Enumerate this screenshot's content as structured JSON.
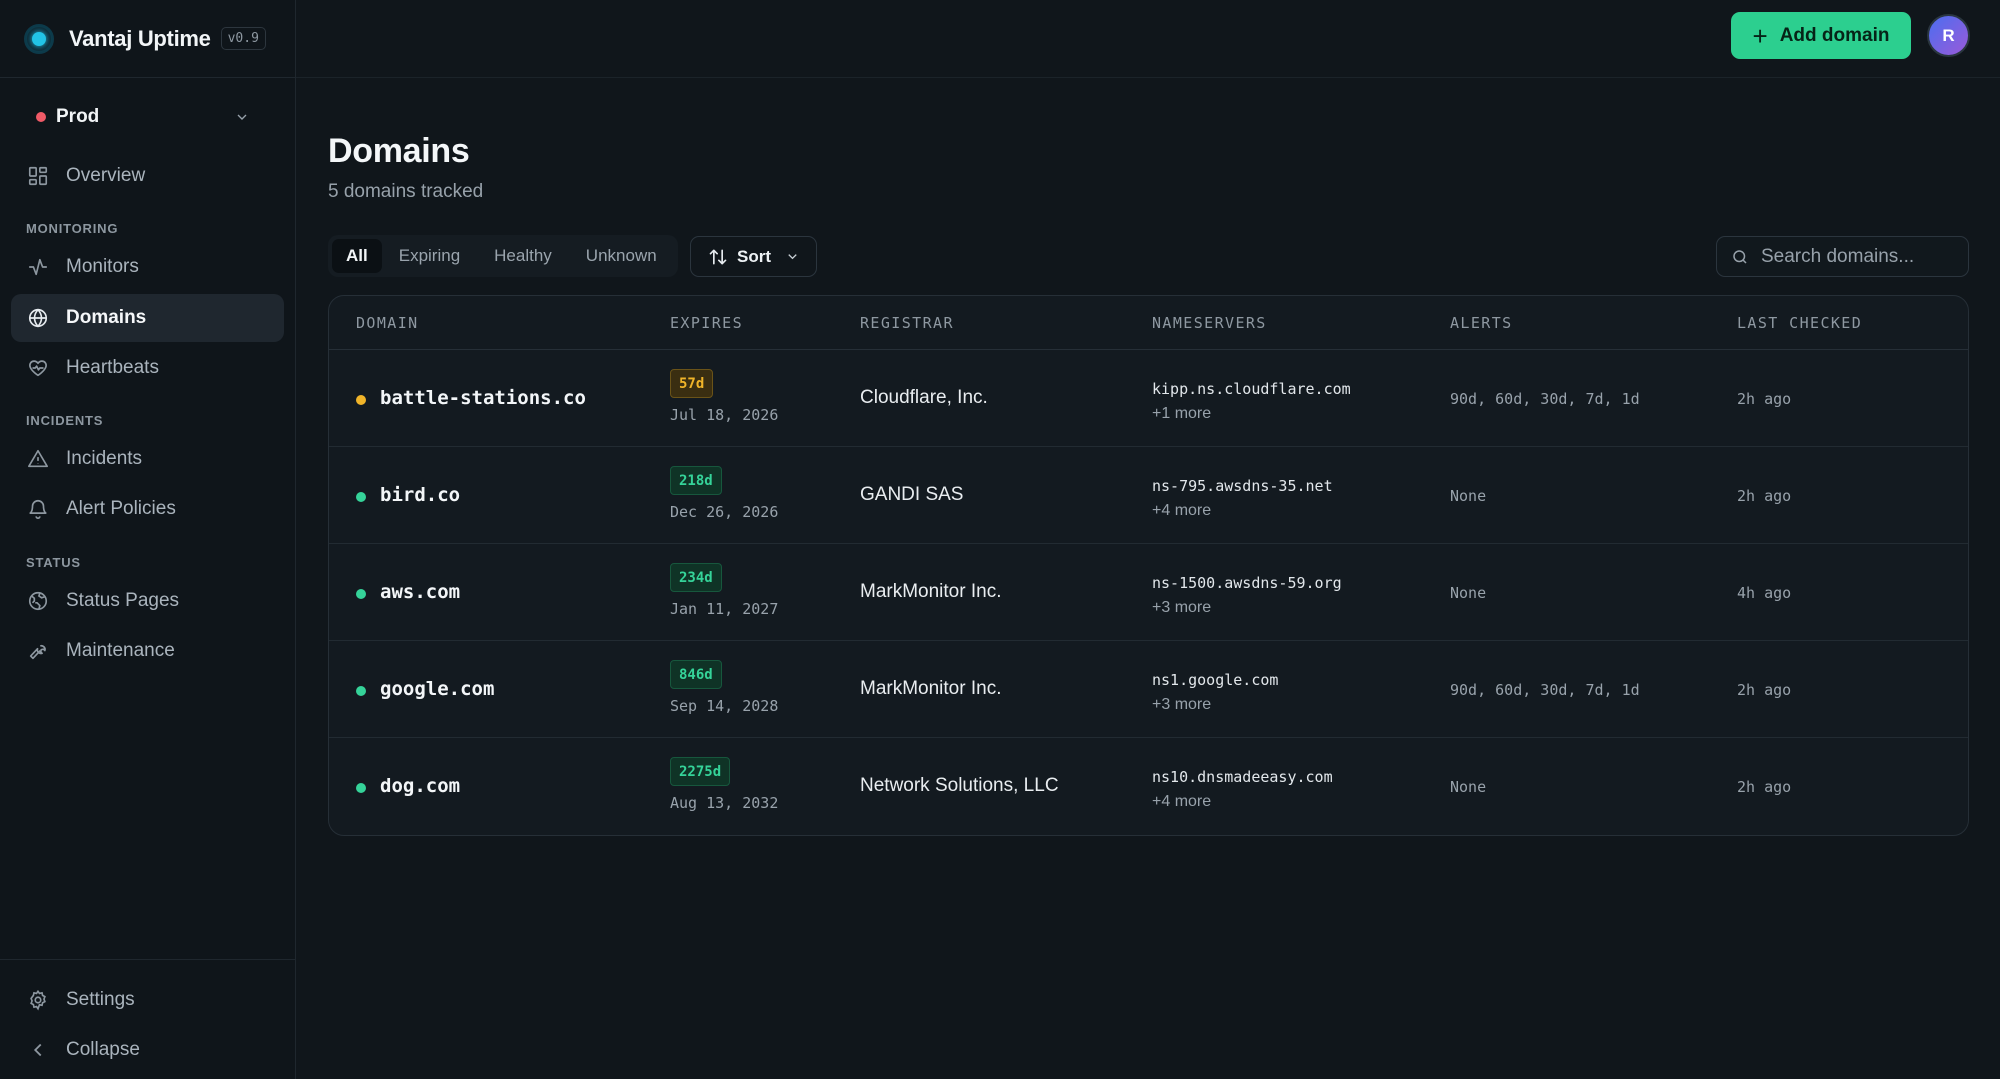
{
  "app": {
    "name": "Vantaj Uptime",
    "version": "v0.9"
  },
  "environment": {
    "name": "Prod",
    "status_color": "#f05a67"
  },
  "sidebar": {
    "overview": "Overview",
    "sections": {
      "monitoring": "MONITORING",
      "incidents": "INCIDENTS",
      "status": "STATUS"
    },
    "items": {
      "monitors": "Monitors",
      "domains": "Domains",
      "heartbeats": "Heartbeats",
      "incidents": "Incidents",
      "alert_policies": "Alert Policies",
      "status_pages": "Status Pages",
      "maintenance": "Maintenance",
      "settings": "Settings",
      "collapse": "Collapse"
    },
    "active": "domains"
  },
  "topbar": {
    "add_label": "Add domain",
    "avatar_initial": "R"
  },
  "page": {
    "title": "Domains",
    "subtitle": "5 domains tracked"
  },
  "filters": {
    "tabs": [
      "All",
      "Expiring",
      "Healthy",
      "Unknown"
    ],
    "active": "All",
    "sort_label": "Sort",
    "search_placeholder": "Search domains..."
  },
  "colors": {
    "accent": "#2ccf8f",
    "warning": "#f0b429",
    "healthy": "#35d399"
  },
  "table": {
    "columns": [
      "DOMAIN",
      "EXPIRES",
      "REGISTRAR",
      "NAMESERVERS",
      "ALERTS",
      "LAST CHECKED"
    ],
    "rows": [
      {
        "domain": "battle-stations.co",
        "status": "warning",
        "days": "57d",
        "date": "Jul 18, 2026",
        "registrar": "Cloudflare, Inc.",
        "ns": "kipp.ns.cloudflare.com",
        "ns_more": "+1 more",
        "alerts": "90d, 60d, 30d, 7d, 1d",
        "checked": "2h ago"
      },
      {
        "domain": "bird.co",
        "status": "healthy",
        "days": "218d",
        "date": "Dec 26, 2026",
        "registrar": "GANDI SAS",
        "ns": "ns-795.awsdns-35.net",
        "ns_more": "+4 more",
        "alerts": "None",
        "checked": "2h ago"
      },
      {
        "domain": "aws.com",
        "status": "healthy",
        "days": "234d",
        "date": "Jan 11, 2027",
        "registrar": "MarkMonitor Inc.",
        "ns": "ns-1500.awsdns-59.org",
        "ns_more": "+3 more",
        "alerts": "None",
        "checked": "4h ago"
      },
      {
        "domain": "google.com",
        "status": "healthy",
        "days": "846d",
        "date": "Sep 14, 2028",
        "registrar": "MarkMonitor Inc.",
        "ns": "ns1.google.com",
        "ns_more": "+3 more",
        "alerts": "90d, 60d, 30d, 7d, 1d",
        "checked": "2h ago"
      },
      {
        "domain": "dog.com",
        "status": "healthy",
        "days": "2275d",
        "date": "Aug 13, 2032",
        "registrar": "Network Solutions, LLC",
        "ns": "ns10.dnsmadeeasy.com",
        "ns_more": "+4 more",
        "alerts": "None",
        "checked": "2h ago"
      }
    ]
  }
}
